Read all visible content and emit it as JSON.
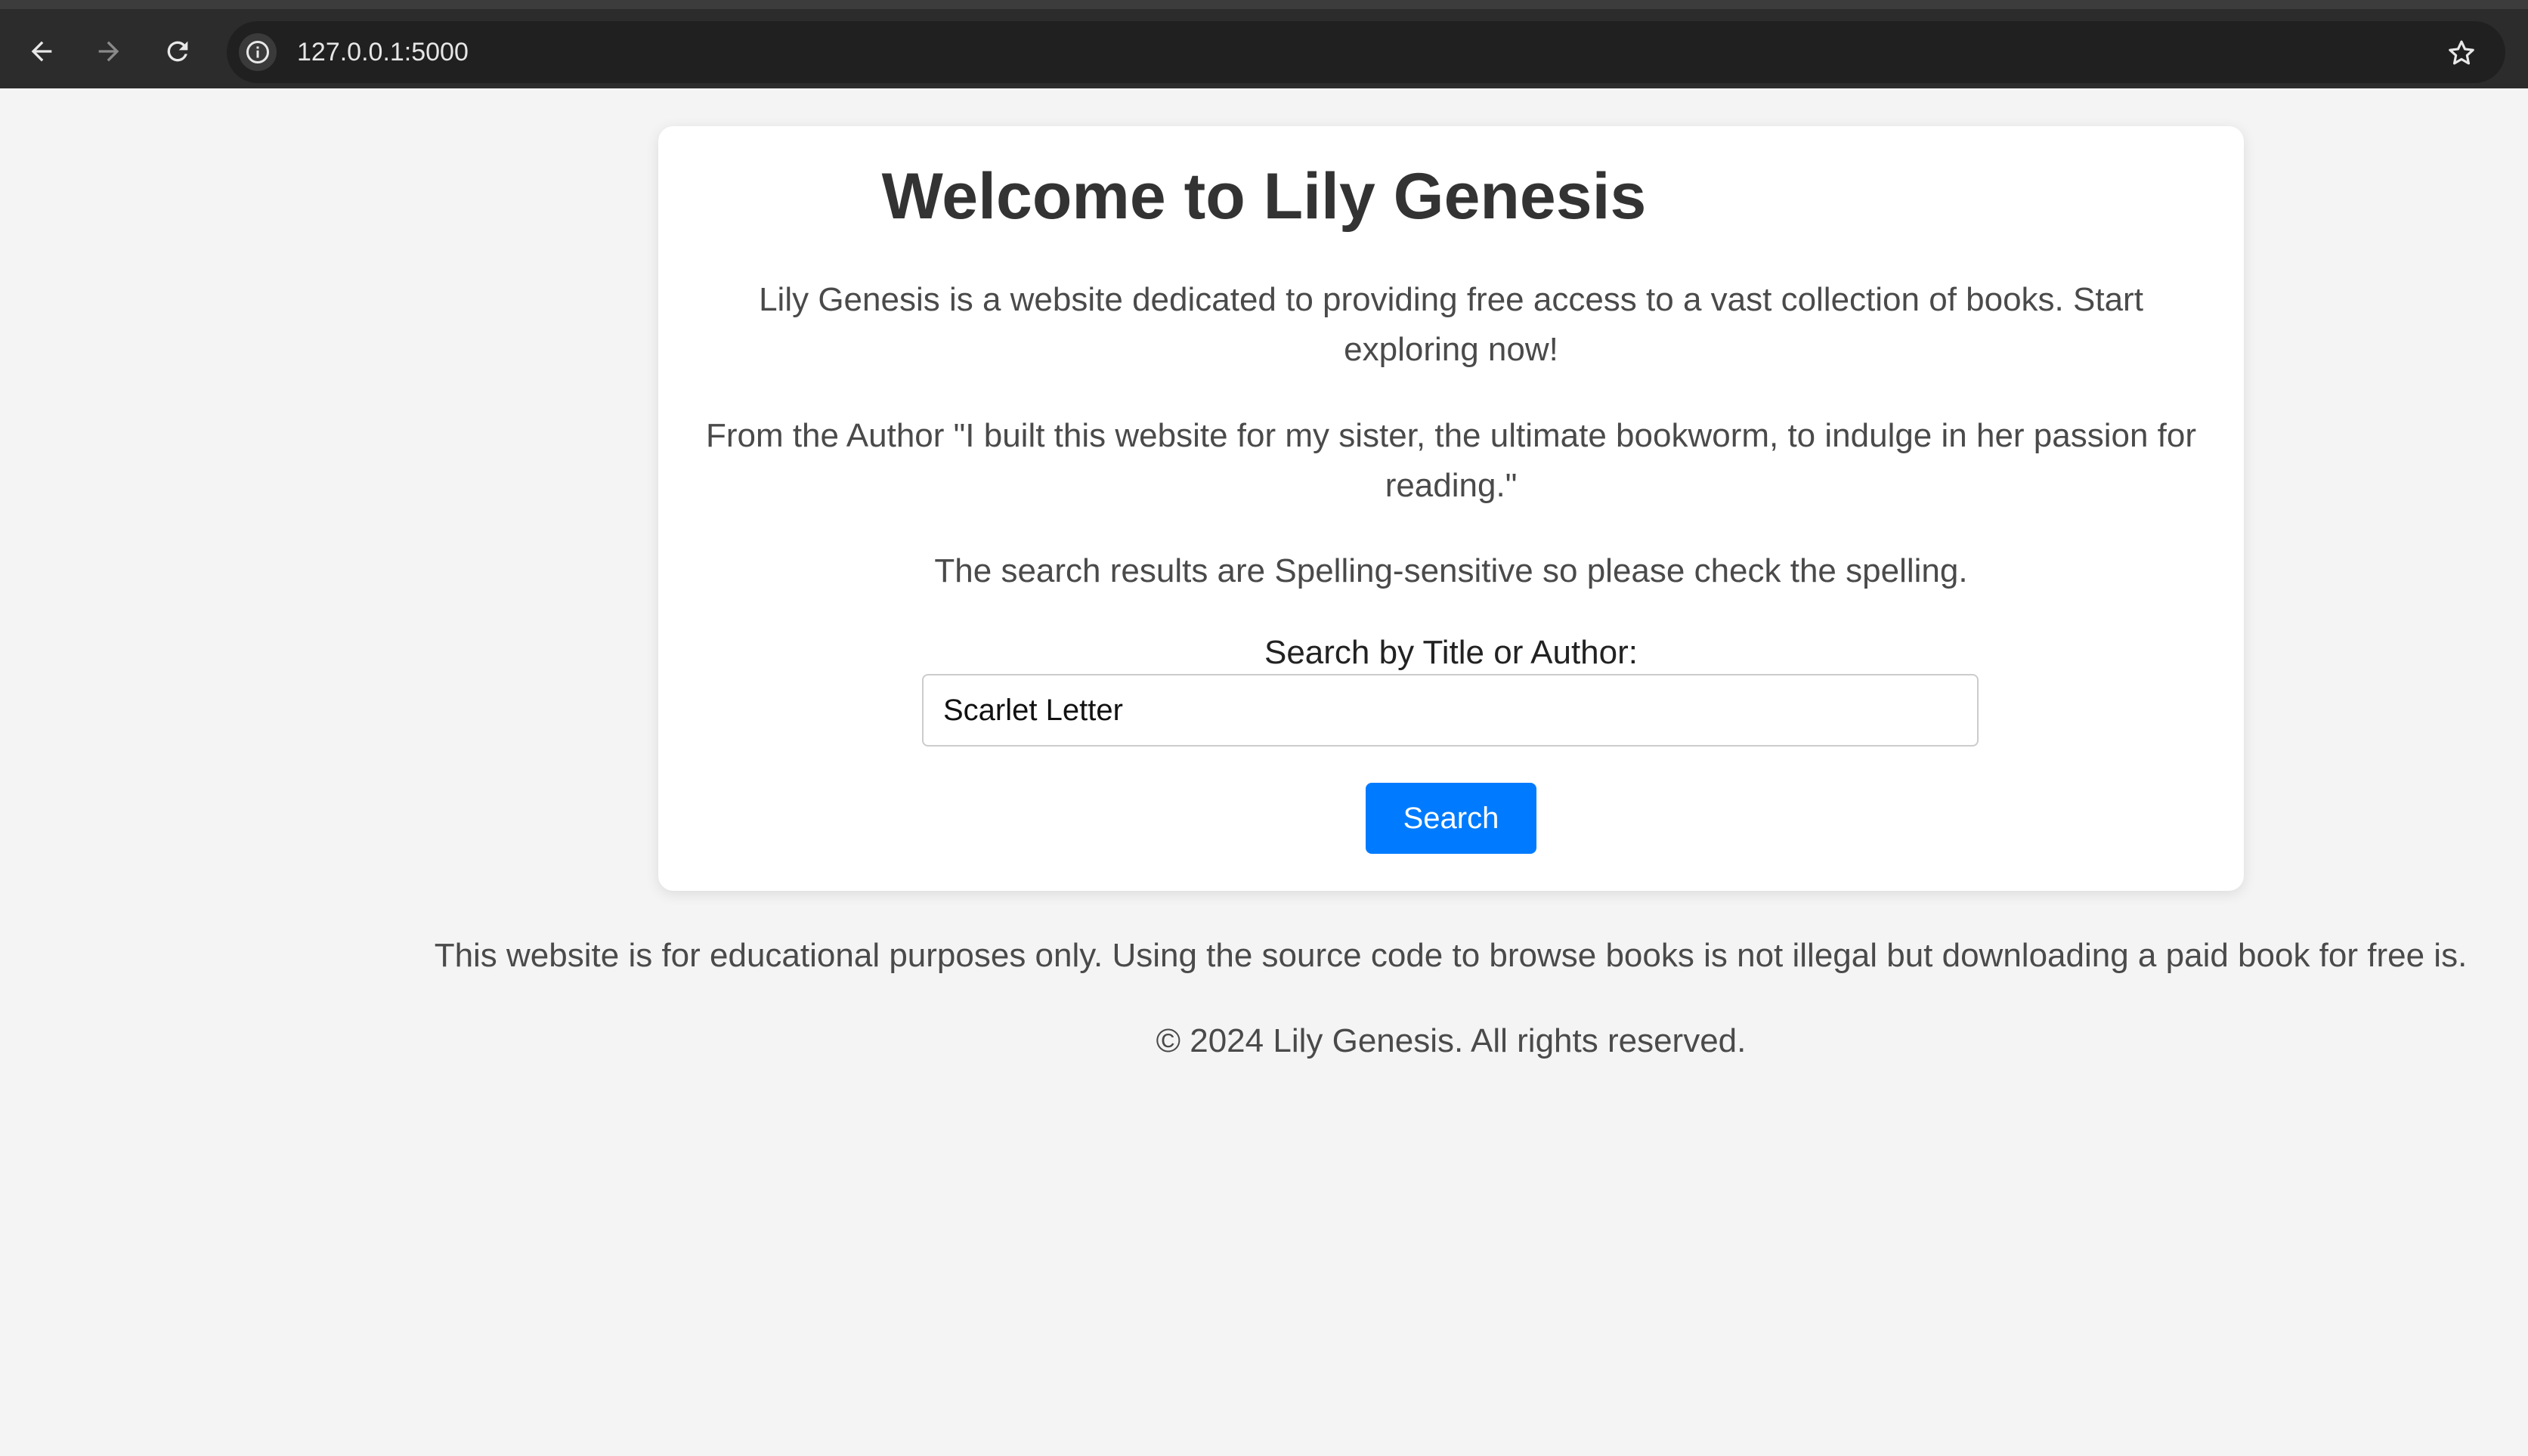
{
  "browser": {
    "url": "127.0.0.1:5000",
    "back_icon": "arrow-left-icon",
    "forward_icon": "arrow-right-icon",
    "reload_icon": "reload-icon",
    "site_info_icon": "info-icon",
    "bookmark_icon": "star-icon"
  },
  "main": {
    "title": "Welcome to Lily Genesis",
    "intro": "Lily Genesis is a website dedicated to providing free access to a vast collection of books. Start exploring now!",
    "author_note": "From the Author \"I built this website for my sister, the ultimate bookworm, to indulge in her passion for reading.\"",
    "spelling_note": "The search results are Spelling-sensitive so please check the spelling.",
    "search": {
      "label": "Search by Title or Author:",
      "value": "Scarlet Letter",
      "button_label": "Search"
    }
  },
  "footer": {
    "disclaimer": "This website is for educational purposes only. Using the source code to browse books is not illegal but downloading a paid book for free is.",
    "copyright": "© 2024 Lily Genesis. All rights reserved."
  },
  "colors": {
    "accent": "#007bff",
    "page_background": "#f4f4f4",
    "card_background": "#ffffff",
    "chrome_background": "#2c2c2c"
  }
}
